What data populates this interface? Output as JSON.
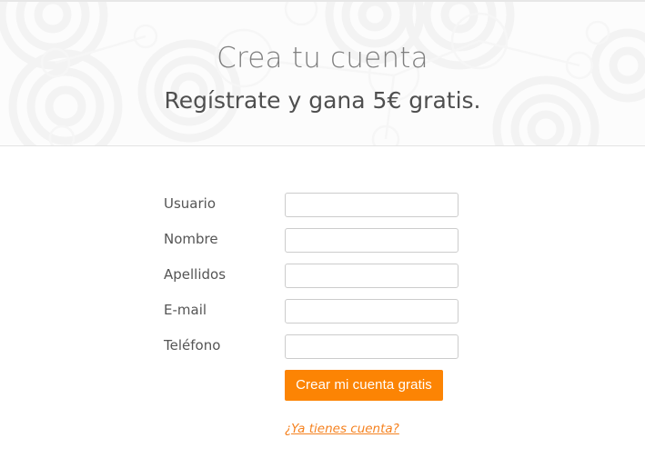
{
  "hero": {
    "title": "Crea tu cuenta",
    "subtitle": "Regístrate y gana 5€ gratis."
  },
  "form": {
    "fields": [
      {
        "label": "Usuario",
        "value": "",
        "placeholder": ""
      },
      {
        "label": "Nombre",
        "value": "",
        "placeholder": ""
      },
      {
        "label": "Apellidos",
        "value": "",
        "placeholder": ""
      },
      {
        "label": "E-mail",
        "value": "",
        "placeholder": ""
      },
      {
        "label": "Teléfono",
        "value": "",
        "placeholder": ""
      }
    ],
    "submit_label": "Crear mi cuenta gratis",
    "account_link_label": "¿Ya tienes cuenta?"
  },
  "colors": {
    "accent_orange": "#fc8404",
    "link_orange": "#f58220",
    "title_gray": "#7e7e7e",
    "subtitle_gray": "#4f4f4f",
    "label_gray": "#555555",
    "input_border": "#cccccc",
    "hero_background": "#fcfcfc",
    "hero_pattern": "#f4f4f4",
    "divider": "#e3e3e3",
    "page_background": "#ffffff"
  }
}
